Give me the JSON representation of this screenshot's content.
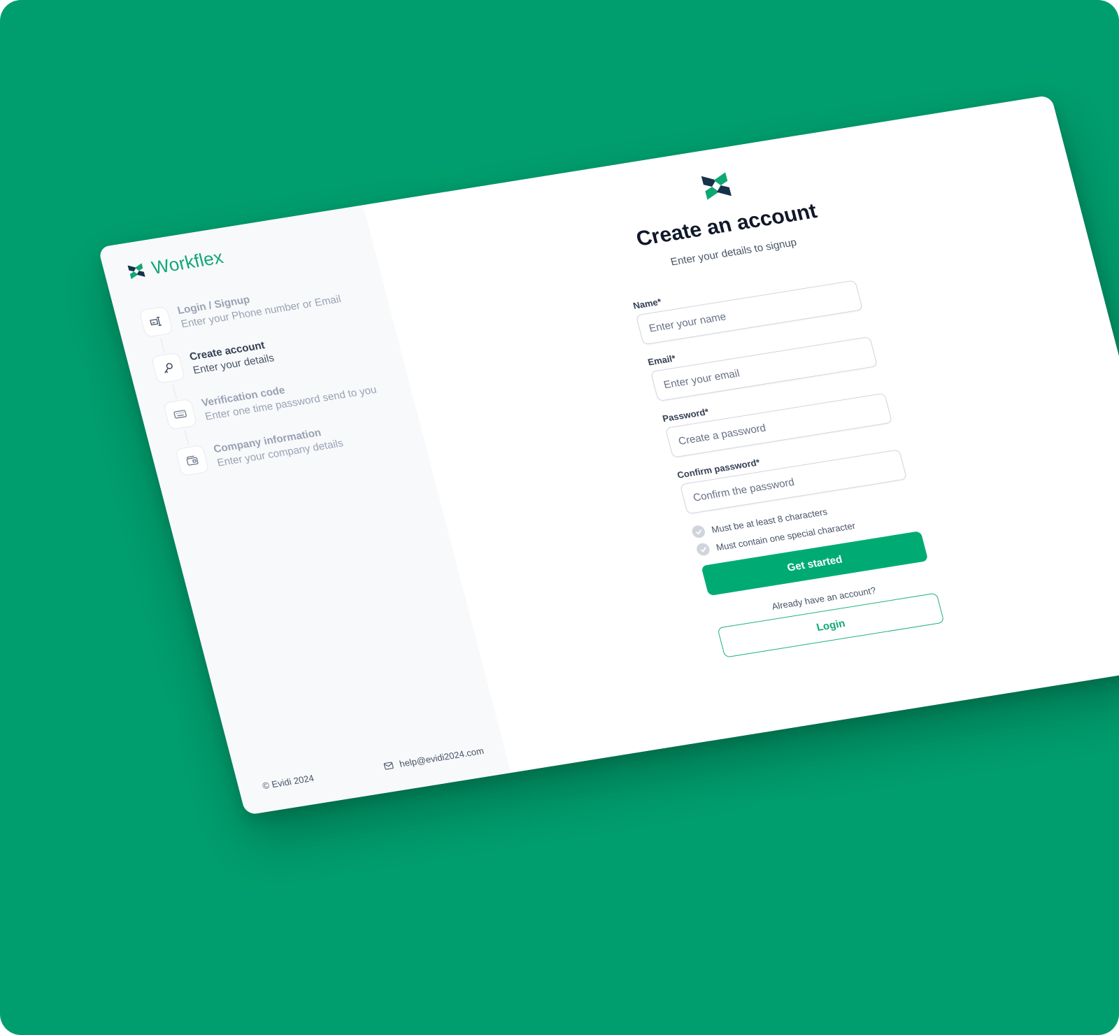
{
  "colors": {
    "background": "#009e6e",
    "brand": "#0fa872",
    "primary_button": "#00ab73",
    "sidebar": "#f8f9fb",
    "logo_dark": "#16324a"
  },
  "brand": {
    "name": "Workflex",
    "logo_icon": "workflex-logo-icon"
  },
  "steps": [
    {
      "icon": "phone-icon",
      "title": "Login / Signup",
      "subtitle": "Enter your Phone number or Email",
      "active": false
    },
    {
      "icon": "key-icon",
      "title": "Create account",
      "subtitle": "Enter your details",
      "active": true
    },
    {
      "icon": "keyboard-icon",
      "title": "Verification code",
      "subtitle": "Enter one time password send to you",
      "active": false
    },
    {
      "icon": "wallet-icon",
      "title": "Company information",
      "subtitle": "Enter your company details",
      "active": false
    }
  ],
  "footer": {
    "copyright": "© Evidi 2024",
    "email": "help@evidi2024.com",
    "email_icon": "mail-icon"
  },
  "main": {
    "title": "Create an account",
    "subtitle": "Enter your details to signup"
  },
  "form": {
    "fields": [
      {
        "label": "Name*",
        "placeholder": "Enter your name",
        "value": ""
      },
      {
        "label": "Email*",
        "placeholder": "Enter your email",
        "value": ""
      },
      {
        "label": "Password*",
        "placeholder": "Create a password",
        "value": ""
      },
      {
        "label": "Confirm password*",
        "placeholder": "Confirm the password",
        "value": ""
      }
    ],
    "requirements": [
      {
        "text": "Must be at least 8 characters",
        "met": false
      },
      {
        "text": "Must contain one special character",
        "met": false
      }
    ],
    "submit_label": "Get started",
    "already_text": "Already have an account?",
    "login_label": "Login"
  }
}
